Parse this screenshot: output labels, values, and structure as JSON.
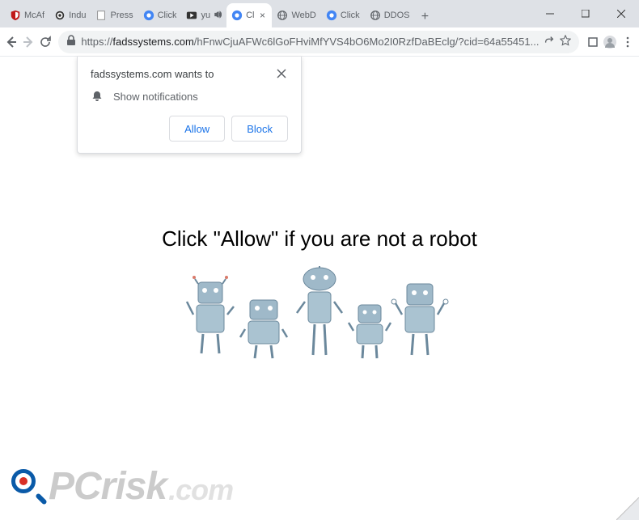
{
  "tabs": {
    "items": [
      {
        "title": "McAf"
      },
      {
        "title": "Indu"
      },
      {
        "title": "Press"
      },
      {
        "title": "Click"
      },
      {
        "title": "yu",
        "audio": true
      },
      {
        "title": "Cl",
        "active": true
      },
      {
        "title": "WebD"
      },
      {
        "title": "Click"
      },
      {
        "title": "DDOS"
      }
    ],
    "new_tab": "+"
  },
  "window": {
    "minimize": "—",
    "maximize": "☐",
    "close": "✕"
  },
  "toolbar": {
    "scheme": "https://",
    "host": "fadssystems.com",
    "path": "/hFnwCjuAFWc6lGoFHviMfYVS4bO6Mo2I0RzfDaBEclg/?cid=64a55451..."
  },
  "permission": {
    "title": "fadssystems.com wants to",
    "body": "Show notifications",
    "allow": "Allow",
    "block": "Block"
  },
  "page": {
    "heading": "Click \"Allow\"   if you are not   a robot"
  },
  "watermark": {
    "brand": "PCrisk",
    "domain": ".com"
  }
}
